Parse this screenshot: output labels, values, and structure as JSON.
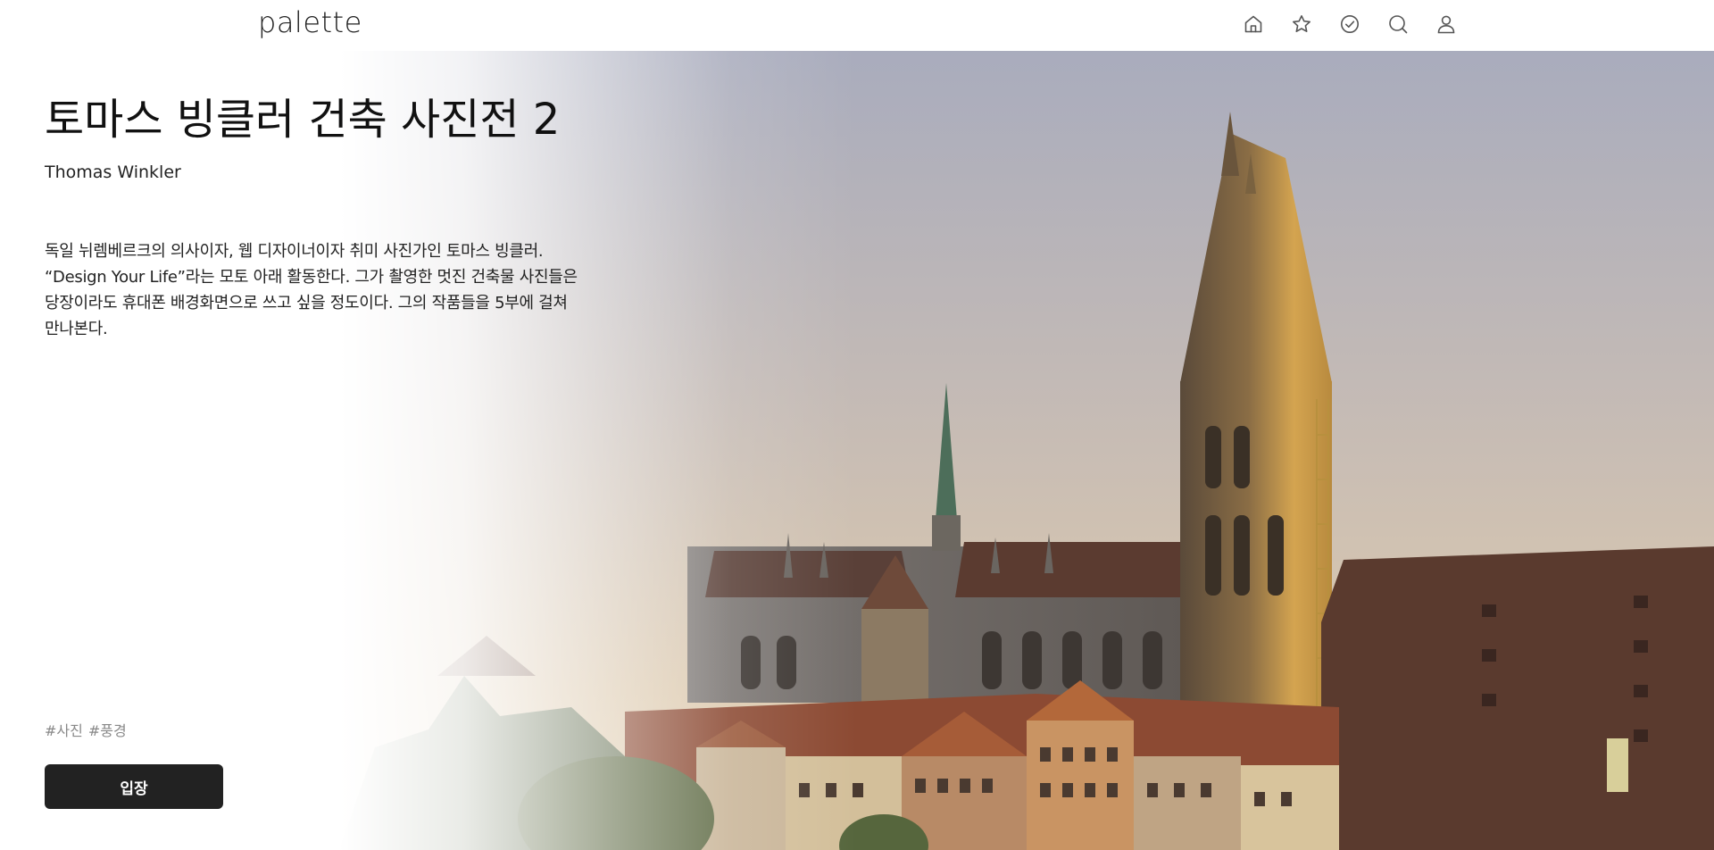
{
  "header": {
    "logo": "palette",
    "nav_icons": [
      "home-icon",
      "star-icon",
      "check-circle-icon",
      "search-icon",
      "user-icon"
    ]
  },
  "exhibition": {
    "title": "토마스 빙클러 건축 사진전 2",
    "artist": "Thomas Winkler",
    "description": "독일 뉘렘베르크의 의사이자, 웹 디자이너이자 취미 사진가인 토마스 빙클러. “Design Your Life”라는 모토 아래 활동한다. 그가 촬영한 멋진 건축물 사진들은 당장이라도 휴대폰 배경화면으로 쓰고 싶을 정도이다. 그의 작품들을 5부에 걸쳐 만나본다.",
    "tags": [
      "#사진",
      "#풍경"
    ],
    "enter_label": "입장"
  },
  "colors": {
    "button_bg": "#222222",
    "button_text": "#ffffff",
    "tag_text": "#888888",
    "icon_stroke": "#555555"
  }
}
